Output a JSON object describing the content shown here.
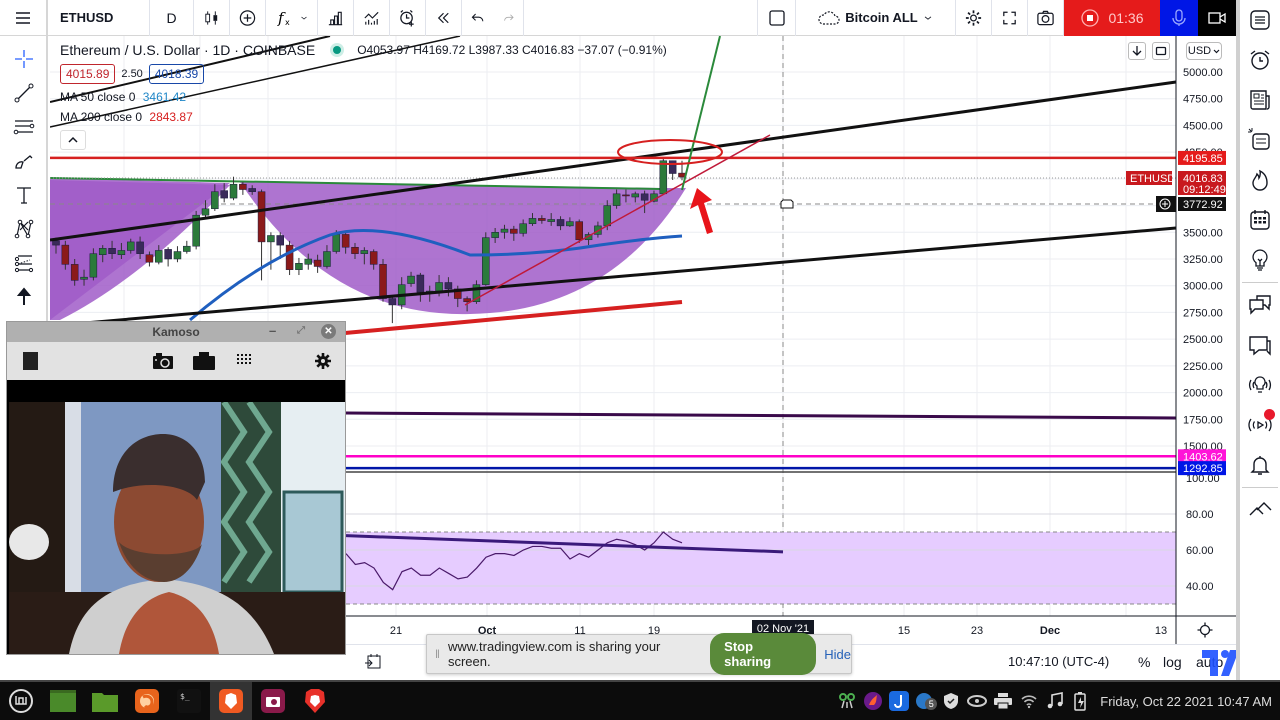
{
  "topbar": {
    "symbol": "ETHUSD",
    "interval": "D",
    "layout_name": "Bitcoin ALL",
    "recording_time": "01:36",
    "icons": [
      "menu-icon",
      "candles-icon",
      "compare-add-icon",
      "indicators-icon",
      "chevron-down-icon",
      "financials-icon",
      "templates-icon",
      "alert-add-icon",
      "replay-icon",
      "undo-icon",
      "redo-icon",
      "square-icon",
      "cloud-icon",
      "gear-icon",
      "fullscreen-icon",
      "camera-icon",
      "stop-record-icon",
      "microphone-icon",
      "video-camera-icon"
    ]
  },
  "legend": {
    "title": "Ethereum / U.S. Dollar · 1D · COINBASE",
    "ohlc": "O4053.97  H4169.72  L3987.33  C4016.83  −37.07 (−0.91%)",
    "bid": "4015.89",
    "spread": "2.50",
    "ask": "4018.39",
    "ma50_label": "MA 50 close 0",
    "ma50_value": "3461.42",
    "ma200_label": "MA 200 close 0",
    "ma200_value": "2843.87"
  },
  "colors": {
    "up": "#2b7a3b",
    "down": "#8b1a1a",
    "ma50": "#1f5fbf",
    "ma200": "#d62020",
    "cup_fill": "#a05cc8",
    "resistance": "#d62020",
    "record": "#e51b1b",
    "mic": "#0016e6",
    "rsi_band": "#e6ccff",
    "rsi_line": "#4a1a6a",
    "stop_sharing": "#5a8a3a"
  },
  "price_axis": {
    "currency": "USD",
    "ticks": [
      "5000.00",
      "4750.00",
      "4500.00",
      "4250.00",
      "4000.00",
      "3750.00",
      "3500.00",
      "3250.00",
      "3000.00",
      "2750.00",
      "2500.00",
      "2250.00",
      "2000.00",
      "1750.00",
      "1500.00"
    ],
    "tags": [
      {
        "label": "4195.85",
        "kind": "red"
      },
      {
        "label": "4016.83",
        "sub": "09:12:49",
        "kind": "last",
        "symbol": "ETHUSD"
      },
      {
        "label": "3772.92",
        "kind": "crosshair"
      },
      {
        "label": "1403.62",
        "kind": "magenta"
      },
      {
        "label": "1292.85",
        "kind": "blue"
      }
    ]
  },
  "rsi_axis": {
    "ticks": [
      "100.00",
      "80.00",
      "60.00",
      "40.00"
    ]
  },
  "time_axis": {
    "ticks": [
      "21",
      "Oct",
      "11",
      "19",
      "15",
      "23",
      "Dec",
      "13"
    ],
    "crosshair_label": "02 Nov '21"
  },
  "bottom": {
    "time": "10:47:10 (UTC-4)",
    "percent": "%",
    "log": "log",
    "auto": "auto"
  },
  "webcam": {
    "title": "Kamoso"
  },
  "share_banner": {
    "text": "www.tradingview.com is sharing your screen.",
    "stop": "Stop sharing",
    "hide": "Hide"
  },
  "taskbar": {
    "apps": [
      "mint-menu-icon",
      "terminal-window-icon",
      "files-folder-icon",
      "firefox-icon",
      "terminal-icon",
      "brave-icon",
      "camera-app-icon",
      "brave-lion-icon"
    ],
    "tray": [
      "network-icon",
      "app-icon",
      "joplin-icon",
      "notification-5-icon",
      "shield-icon",
      "nvidia-icon",
      "printer-icon",
      "wifi-icon",
      "music-icon",
      "battery-icon"
    ],
    "notification_count": "5",
    "clock": "Friday, Oct 22 2021 10:47 AM"
  },
  "chart_data": {
    "type": "candlestick",
    "title": "Ethereum / U.S. Dollar · 1D · COINBASE",
    "ylim": [
      1250,
      5100
    ],
    "xlabels": [
      "21",
      "Oct",
      "11",
      "19",
      "02 Nov '21",
      "15",
      "23",
      "Dec",
      "13"
    ],
    "candles": [
      [
        3420,
        3380,
        3450,
        3300
      ],
      [
        3380,
        3200,
        3420,
        3150
      ],
      [
        3200,
        3050,
        3250,
        3000
      ],
      [
        3060,
        3080,
        3150,
        3000
      ],
      [
        3080,
        3300,
        3350,
        3050
      ],
      [
        3290,
        3350,
        3380,
        3220
      ],
      [
        3350,
        3300,
        3420,
        3250
      ],
      [
        3290,
        3330,
        3400,
        3250
      ],
      [
        3330,
        3410,
        3440,
        3300
      ],
      [
        3410,
        3300,
        3460,
        3250
      ],
      [
        3290,
        3220,
        3320,
        3180
      ],
      [
        3220,
        3330,
        3380,
        3200
      ],
      [
        3340,
        3250,
        3360,
        3180
      ],
      [
        3250,
        3320,
        3370,
        3220
      ],
      [
        3320,
        3370,
        3420,
        3300
      ],
      [
        3370,
        3660,
        3700,
        3340
      ],
      [
        3660,
        3720,
        3800,
        3640
      ],
      [
        3720,
        3880,
        3950,
        3700
      ],
      [
        3890,
        3820,
        3960,
        3780
      ],
      [
        3820,
        3950,
        4020,
        3800
      ],
      [
        3950,
        3900,
        3970,
        3850
      ],
      [
        3910,
        3880,
        3940,
        3850
      ],
      [
        3880,
        3410,
        3900,
        3050
      ],
      [
        3410,
        3470,
        3500,
        3150
      ],
      [
        3470,
        3380,
        3500,
        3250
      ],
      [
        3380,
        3150,
        3420,
        3100
      ],
      [
        3150,
        3210,
        3260,
        3100
      ],
      [
        3200,
        3250,
        3300,
        3150
      ],
      [
        3240,
        3180,
        3290,
        3120
      ],
      [
        3180,
        3320,
        3380,
        3160
      ],
      [
        3320,
        3480,
        3520,
        3300
      ],
      [
        3480,
        3360,
        3510,
        3300
      ],
      [
        3360,
        3300,
        3400,
        3250
      ],
      [
        3300,
        3330,
        3360,
        3200
      ],
      [
        3320,
        3200,
        3340,
        3150
      ],
      [
        3200,
        2880,
        3250,
        2850
      ],
      [
        2880,
        2820,
        2900,
        2650
      ],
      [
        2820,
        3010,
        3080,
        2780
      ],
      [
        3020,
        3090,
        3130,
        2990
      ],
      [
        3100,
        2940,
        3120,
        2850
      ],
      [
        2940,
        2950,
        3000,
        2850
      ],
      [
        2950,
        3030,
        3100,
        2900
      ],
      [
        3030,
        2970,
        3080,
        2900
      ],
      [
        2970,
        2880,
        3000,
        2800
      ],
      [
        2880,
        2850,
        2900,
        2760
      ],
      [
        2850,
        3010,
        3050,
        2830
      ],
      [
        3010,
        3450,
        3500,
        3000
      ],
      [
        3450,
        3500,
        3540,
        3400
      ],
      [
        3500,
        3530,
        3570,
        3440
      ],
      [
        3530,
        3490,
        3560,
        3420
      ],
      [
        3490,
        3580,
        3620,
        3460
      ],
      [
        3580,
        3630,
        3680,
        3560
      ],
      [
        3630,
        3610,
        3660,
        3580
      ],
      [
        3600,
        3620,
        3680,
        3560
      ],
      [
        3620,
        3560,
        3650,
        3520
      ],
      [
        3560,
        3600,
        3640,
        3550
      ],
      [
        3600,
        3430,
        3620,
        3400
      ],
      [
        3430,
        3480,
        3500,
        3380
      ],
      [
        3480,
        3560,
        3600,
        3450
      ],
      [
        3560,
        3750,
        3800,
        3520
      ],
      [
        3750,
        3860,
        3900,
        3720
      ],
      [
        3850,
        3840,
        3900,
        3780
      ],
      [
        3830,
        3860,
        3880,
        3780
      ],
      [
        3860,
        3800,
        3890,
        3680
      ],
      [
        3790,
        3860,
        3890,
        3780
      ],
      [
        3860,
        4170,
        4200,
        3850
      ],
      [
        4170,
        4050,
        4170,
        3990
      ],
      [
        4053.97,
        4016.83,
        4169.72,
        3987.33
      ]
    ],
    "ma50": "rising blue curve from ~2700 to ~3450",
    "ma50_value": 3461.42,
    "ma200_value": 2843.87,
    "horizontal_levels": [
      {
        "price": 4195.85,
        "color": "red"
      },
      {
        "price": 1750,
        "color": "purple"
      },
      {
        "price": 1403.62,
        "color": "magenta"
      },
      {
        "price": 1292.85,
        "color": "blue"
      }
    ],
    "rsi": {
      "ylim": [
        30,
        100
      ],
      "band": [
        30,
        70
      ],
      "values": [
        58,
        52,
        53,
        50,
        42,
        38,
        48,
        50,
        46,
        46,
        50,
        47,
        44,
        45,
        50,
        56,
        58,
        58,
        57,
        60,
        62,
        62,
        61,
        61,
        55,
        58,
        56,
        60,
        64,
        66,
        65,
        63,
        60,
        64,
        70,
        66,
        64
      ],
      "trendline": [
        68,
        59
      ]
    }
  }
}
